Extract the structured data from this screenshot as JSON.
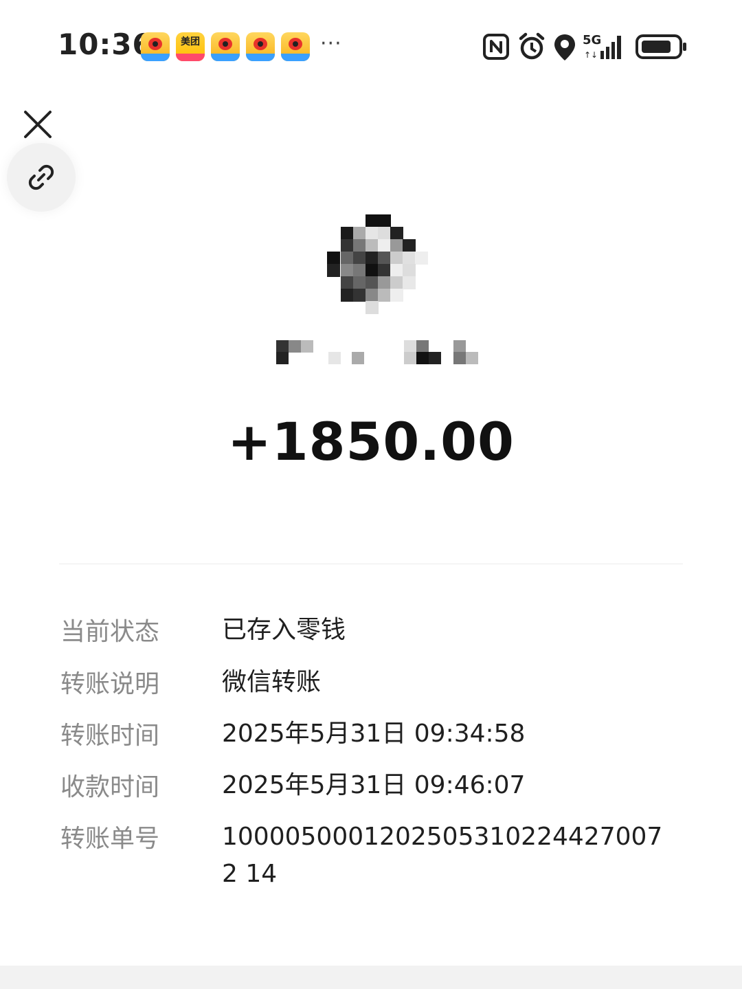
{
  "status_bar": {
    "time": "10:36",
    "notifications": [
      {
        "app": "weibo",
        "icon": "weibo-icon"
      },
      {
        "app": "meituan",
        "icon": "meituan-icon",
        "label": "美团"
      },
      {
        "app": "weibo",
        "icon": "weibo-icon"
      },
      {
        "app": "weibo",
        "icon": "weibo-icon"
      },
      {
        "app": "weibo",
        "icon": "weibo-icon"
      }
    ],
    "more": "···",
    "network": "5G",
    "indicators": [
      "nfc-icon",
      "alarm-icon",
      "location-icon",
      "signal-icon",
      "battery-icon"
    ]
  },
  "controls": {
    "close_icon": "close-icon",
    "link_icon": "link-icon"
  },
  "transfer": {
    "amount": "+1850.00"
  },
  "details": [
    {
      "label": "当前状态",
      "value": "已存入零钱"
    },
    {
      "label": "转账说明",
      "value": "微信转账"
    },
    {
      "label": "转账时间",
      "value": "2025年5月31日 09:34:58"
    },
    {
      "label": "收款时间",
      "value": "2025年5月31日 09:46:07"
    },
    {
      "label": "转账单号",
      "value": "10000500012025053102244270072 14"
    }
  ]
}
